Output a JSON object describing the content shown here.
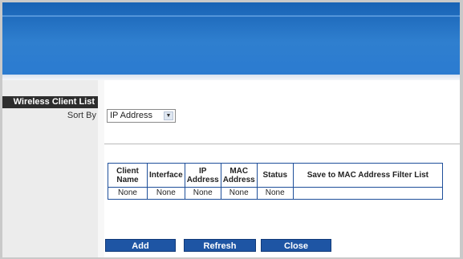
{
  "section": {
    "title": "Wireless Client List"
  },
  "sort": {
    "label": "Sort By",
    "selected": "IP Address"
  },
  "table": {
    "headers": [
      "Client Name",
      "Interface",
      "IP Address",
      "MAC Address",
      "Status",
      "Save to MAC Address Filter List"
    ],
    "rows": [
      [
        "None",
        "None",
        "None",
        "None",
        "None",
        ""
      ]
    ]
  },
  "buttons": {
    "add": "Add",
    "refresh": "Refresh",
    "close": "Close"
  },
  "colors": {
    "banner": "#2b7bd0",
    "section_bg": "#2d2d2d",
    "button_bg": "#1e55a4",
    "table_border": "#1e4f9a"
  },
  "icons": {
    "select_arrow": "chevron-down-icon"
  }
}
